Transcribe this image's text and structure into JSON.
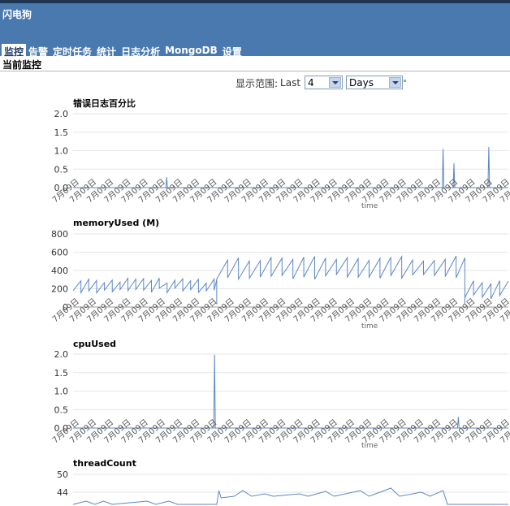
{
  "app": {
    "title": "闪电狗"
  },
  "nav": [
    {
      "label": "监控",
      "active": true
    },
    {
      "label": "告警",
      "active": false
    },
    {
      "label": "定时任务",
      "active": false
    },
    {
      "label": "统计",
      "active": false
    },
    {
      "label": "日志分析",
      "active": false
    },
    {
      "label": "MongoDB",
      "active": false
    },
    {
      "label": "设置",
      "active": false
    }
  ],
  "section": {
    "title": "当前监控"
  },
  "range": {
    "label": "显示范围:",
    "prefix": "Last",
    "count": "4",
    "unit": "Days"
  },
  "colors": {
    "header": "#4a79b0",
    "line": "#5b87c5",
    "grid": "#e6e6e6"
  },
  "xtick_label": "7月09日",
  "x_axis_label": "time",
  "chart_data": [
    {
      "type": "line",
      "title": "错误日志百分比",
      "ylim": [
        0,
        2
      ],
      "yticks": [
        "2.0",
        "1.5",
        "1.0",
        "0.5",
        "0.0"
      ],
      "spikes": [
        [
          0.215,
          0.28
        ],
        [
          0.85,
          1.05
        ],
        [
          0.875,
          0.66
        ],
        [
          0.955,
          1.1
        ]
      ]
    },
    {
      "type": "line",
      "title": "memoryUsed (M)",
      "ylim": [
        0,
        800
      ],
      "yticks": [
        "800",
        "600",
        "400",
        "200",
        "0"
      ],
      "segments": [
        {
          "from": 0.0,
          "to": 0.33,
          "low": 150,
          "high": 320,
          "period": 0.018
        },
        {
          "from": 0.33,
          "to": 0.9,
          "low": 300,
          "high": 560,
          "period": 0.025
        },
        {
          "from": 0.9,
          "to": 1.0,
          "low": 90,
          "high": 310,
          "period": 0.02
        }
      ]
    },
    {
      "type": "line",
      "title": "cpuUsed",
      "ylim": [
        0,
        2
      ],
      "yticks": [
        "2.0",
        "1.5",
        "1.0",
        "0.5",
        "0.0"
      ],
      "spikes": [
        [
          0.325,
          1.98
        ],
        [
          0.885,
          0.3
        ]
      ]
    },
    {
      "type": "line",
      "title": "threadCount",
      "yticks": [
        "50",
        "44"
      ],
      "yvals": [
        50,
        44
      ]
    }
  ]
}
